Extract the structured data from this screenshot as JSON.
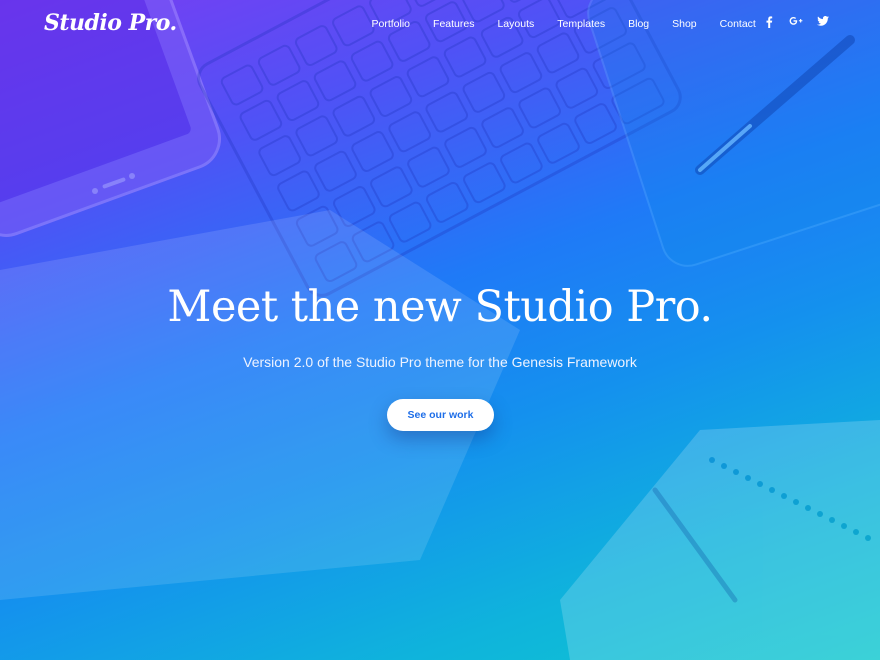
{
  "header": {
    "logo_text": "Studio Pro.",
    "nav": [
      {
        "label": "Portfolio"
      },
      {
        "label": "Features"
      },
      {
        "label": "Layouts"
      },
      {
        "label": "Templates"
      },
      {
        "label": "Blog"
      },
      {
        "label": "Shop"
      },
      {
        "label": "Contact"
      }
    ],
    "social": [
      {
        "icon": "facebook-icon",
        "glyph": "f"
      },
      {
        "icon": "google-plus-icon",
        "glyph": "G+"
      },
      {
        "icon": "twitter-icon",
        "glyph": "twitter-bird"
      }
    ]
  },
  "hero": {
    "title": "Meet the new Studio Pro.",
    "subtitle": "Version 2.0 of the Studio Pro theme for the Genesis Framework",
    "cta_label": "See our work"
  },
  "colors": {
    "gradient_start": "#7b3cf2",
    "gradient_mid": "#1f7af7",
    "gradient_end": "#10c8cf",
    "cta_text": "#1e6ee8",
    "text": "#ffffff"
  }
}
